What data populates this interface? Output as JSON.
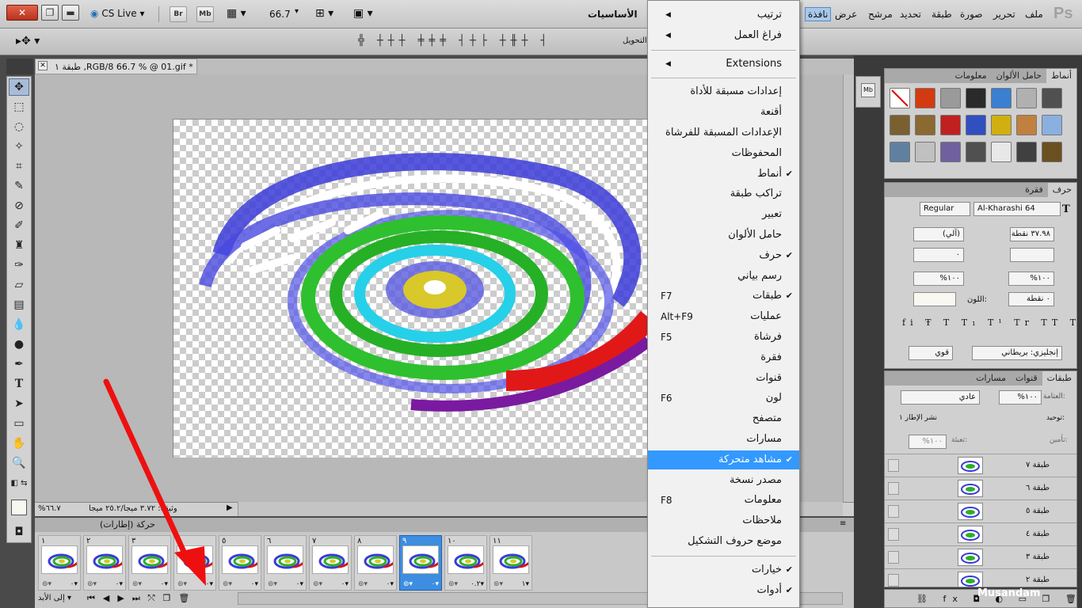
{
  "appbar": {
    "ps_logo": "Ps",
    "menu_items": [
      "ملف",
      "تحرير",
      "صورة",
      "طبقة",
      "تحديد",
      "مرشح",
      "عرض",
      "نافذة"
    ],
    "workspace": "الأساسيات",
    "cs_live": "CS Live",
    "zoom": "66.7",
    "bridge_btn": "Br",
    "minibridge_btn": "Mb"
  },
  "optbar": {
    "auto_transform_label": "التحويل"
  },
  "document": {
    "tab_title": "طبقة ١ ,RGB/8 66.7 % @ 01.gif *",
    "status_zoom": "%٦٦.٧",
    "status_doc": "وثيقة: ٣.٧٢ ميجا/٢٥.٢ ميجا"
  },
  "animation": {
    "panel_title": "حركة (إطارات)",
    "loop_option": "إلى الأبد",
    "frames": [
      {
        "num": "١",
        "dur": "٠"
      },
      {
        "num": "٢",
        "dur": "٠"
      },
      {
        "num": "٣",
        "dur": "٠"
      },
      {
        "num": "٤",
        "dur": "٠"
      },
      {
        "num": "٥",
        "dur": "٠"
      },
      {
        "num": "٦",
        "dur": "٠"
      },
      {
        "num": "٧",
        "dur": "٠"
      },
      {
        "num": "٨",
        "dur": "٠"
      },
      {
        "num": "٩",
        "dur": "٠"
      },
      {
        "num": "١٠",
        "dur": "٠.٢"
      },
      {
        "num": "١١",
        "dur": "١"
      }
    ],
    "selected_frame": 9
  },
  "menu": {
    "items": [
      {
        "label": "ترتيب",
        "submenu": true
      },
      {
        "label": "فراغ العمل",
        "submenu": true
      },
      {
        "sep": true
      },
      {
        "label": "Extensions",
        "submenu": true
      },
      {
        "sep": true
      },
      {
        "label": "إعدادات مسبقة للأداة"
      },
      {
        "label": "أقنعة"
      },
      {
        "label": "الإعدادات المسبقة للفرشاة"
      },
      {
        "label": "المحفوظات"
      },
      {
        "label": "أنماط",
        "checked": true
      },
      {
        "label": "تراكب طبقة"
      },
      {
        "label": "تعبير"
      },
      {
        "label": "حامل الألوان"
      },
      {
        "label": "حرف",
        "checked": true
      },
      {
        "label": "رسم بياني"
      },
      {
        "label": "طبقات",
        "checked": true,
        "key": "F7"
      },
      {
        "label": "عمليات",
        "key": "Alt+F9"
      },
      {
        "label": "فرشاة",
        "key": "F5"
      },
      {
        "label": "فقرة"
      },
      {
        "label": "قنوات"
      },
      {
        "label": "لون",
        "key": "F6"
      },
      {
        "label": "متصفح"
      },
      {
        "label": "مسارات"
      },
      {
        "label": "مشاهد متحركة",
        "checked": true,
        "highlight": true
      },
      {
        "label": "مصدر نسخة"
      },
      {
        "label": "معلومات",
        "key": "F8"
      },
      {
        "label": "ملاحظات"
      },
      {
        "label": "موضع حروف التشكيل"
      },
      {
        "sep": true
      },
      {
        "label": "خيارات",
        "checked": true
      },
      {
        "label": "أدوات",
        "checked": true
      }
    ]
  },
  "styles_panel": {
    "tabs": [
      "أنماط",
      "حامل الألوان",
      "معلومات"
    ],
    "swatch_colors": [
      "#ffffff",
      "#d43a10",
      "#9a9a9a",
      "#2a2a2a",
      "#3a7fd0",
      "#b0b0b0",
      "#505050",
      "#7a6030",
      "#8a6a30",
      "#c02020",
      "#3050c0",
      "#d0b010",
      "#c08040",
      "#8ab0e0",
      "#6080a0",
      "#c0c0c0",
      "#7060a0",
      "#505050",
      "#e8e8e8",
      "#404040",
      "#6a5020"
    ]
  },
  "char_panel": {
    "tabs": [
      "حرف",
      "فقرة"
    ],
    "font_family": "Al-Kharashi 64",
    "font_style": "Regular",
    "font_size": "٣٧.٩٨ نقطة",
    "leading": "(آلي)",
    "kerning": "",
    "tracking": "٠",
    "vscale": "١٠٠%",
    "hscale": "١٠٠%",
    "baseline": "٠ نقطة",
    "color_label": "اللون:",
    "language": "إنجليزي: بريطاني",
    "antialias": "قوي"
  },
  "layers_panel": {
    "tabs": [
      "طبقات",
      "قنوات",
      "مسارات"
    ],
    "blend_mode": "عادي",
    "opacity_label": "العتامة:",
    "opacity": "١٠٠%",
    "unify_label": "توحيد:",
    "propagate_label": "نشر الإطار ١",
    "lock_label": "تأمين:",
    "fill_label": "تعبئة:",
    "fill": "١٠٠%",
    "layers": [
      "طبقة ٧",
      "طبقة ٦",
      "طبقة ٥",
      "طبقة ٤",
      "طبقة ٣",
      "طبقة ٢"
    ]
  },
  "watermark": "Musandam"
}
